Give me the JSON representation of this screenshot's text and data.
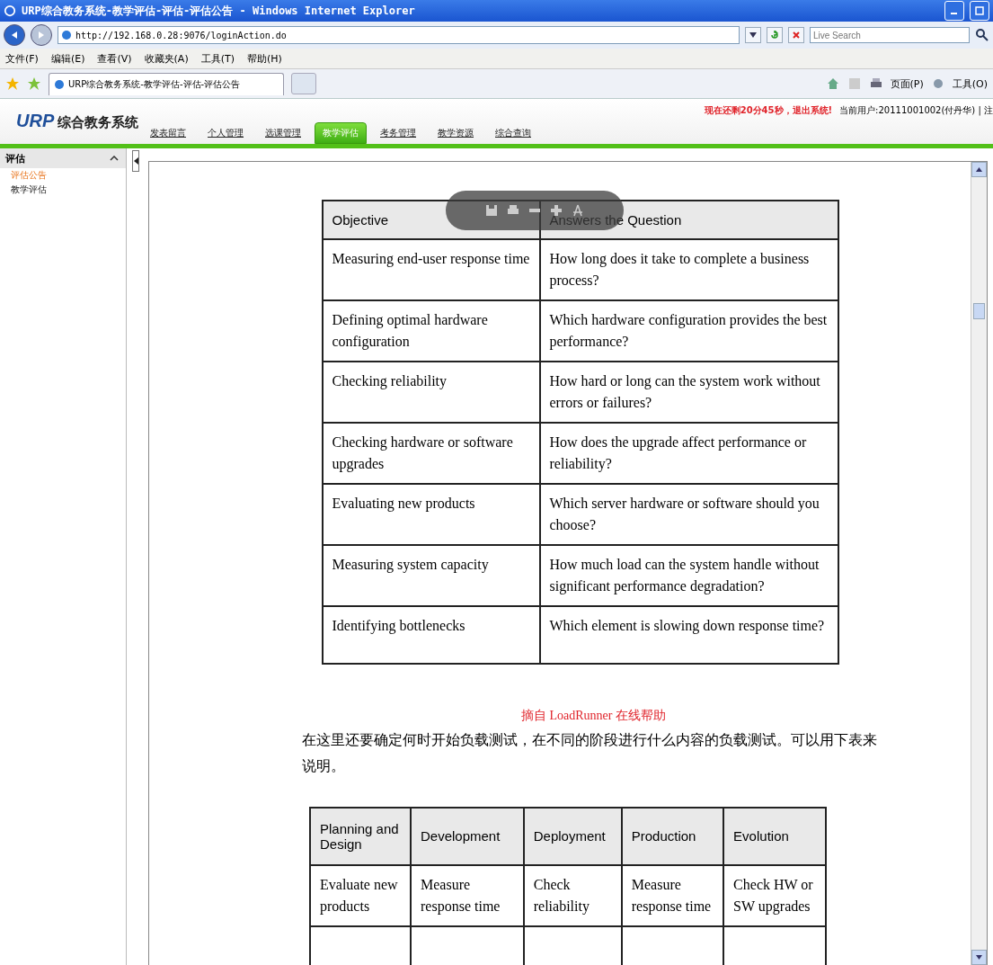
{
  "window": {
    "title": "URP综合教务系统-教学评估-评估-评估公告 - Windows Internet Explorer"
  },
  "address_bar": {
    "url": "http://192.168.0.28:9076/loginAction.do"
  },
  "search": {
    "placeholder": "Live Search"
  },
  "menu": [
    "文件(F)",
    "编辑(E)",
    "查看(V)",
    "收藏夹(A)",
    "工具(T)",
    "帮助(H)"
  ],
  "browser_tab": {
    "title": "URP综合教务系统-教学评估-评估-评估公告"
  },
  "command_bar": [
    "页面(P)",
    "工具(O)"
  ],
  "site": {
    "logo_mark": "URP",
    "logo_text": "综合教务系统",
    "countdown": "现在还剩20分45秒，退出系统!",
    "user": "当前用户:20111001002(付丹华) | 注",
    "nav": [
      {
        "label": "发表留言",
        "selected": false
      },
      {
        "label": "个人管理",
        "selected": false
      },
      {
        "label": "选课管理",
        "selected": false
      },
      {
        "label": "教学评估",
        "selected": true
      },
      {
        "label": "考务管理",
        "selected": false
      },
      {
        "label": "教学资源",
        "selected": false
      },
      {
        "label": "综合查询",
        "selected": false
      }
    ]
  },
  "sidebar": {
    "title": "评估",
    "expanded": true,
    "items": [
      {
        "label": "评估公告",
        "selected": true
      },
      {
        "label": "教学评估",
        "selected": false
      }
    ]
  },
  "document": {
    "table1": {
      "columns": [
        "Objective",
        "Answers the Question"
      ],
      "rows": [
        [
          "Measuring end-user response time",
          "How long does it take to complete a business process?"
        ],
        [
          "Defining optimal hardware configuration",
          "Which hardware configuration provides the best performance?"
        ],
        [
          "Checking reliability",
          "How hard or long can the system work without errors or failures?"
        ],
        [
          "Checking hardware or software upgrades",
          "How does the upgrade affect performance or reliability?"
        ],
        [
          "Evaluating new products",
          "Which server hardware or software should you choose?"
        ],
        [
          "Measuring system capacity",
          "How much load can the system handle without significant performance degradation?"
        ],
        [
          "Identifying bottlenecks",
          "Which element is slowing down response time?"
        ]
      ]
    },
    "caption": "摘自 LoadRunner 在线帮助",
    "paragraph": "在这里还要确定何时开始负载测试，在不同的阶段进行什么内容的负载测试。可以用下表来说明。",
    "table2": {
      "columns": [
        "Planning and Design",
        "Development",
        "Deployment",
        "Production",
        "Evolution"
      ],
      "rows": [
        [
          "Evaluate new products",
          "Measure response time",
          "Check reliability",
          "Measure response time",
          "Check HW or SW upgrades"
        ]
      ]
    }
  }
}
